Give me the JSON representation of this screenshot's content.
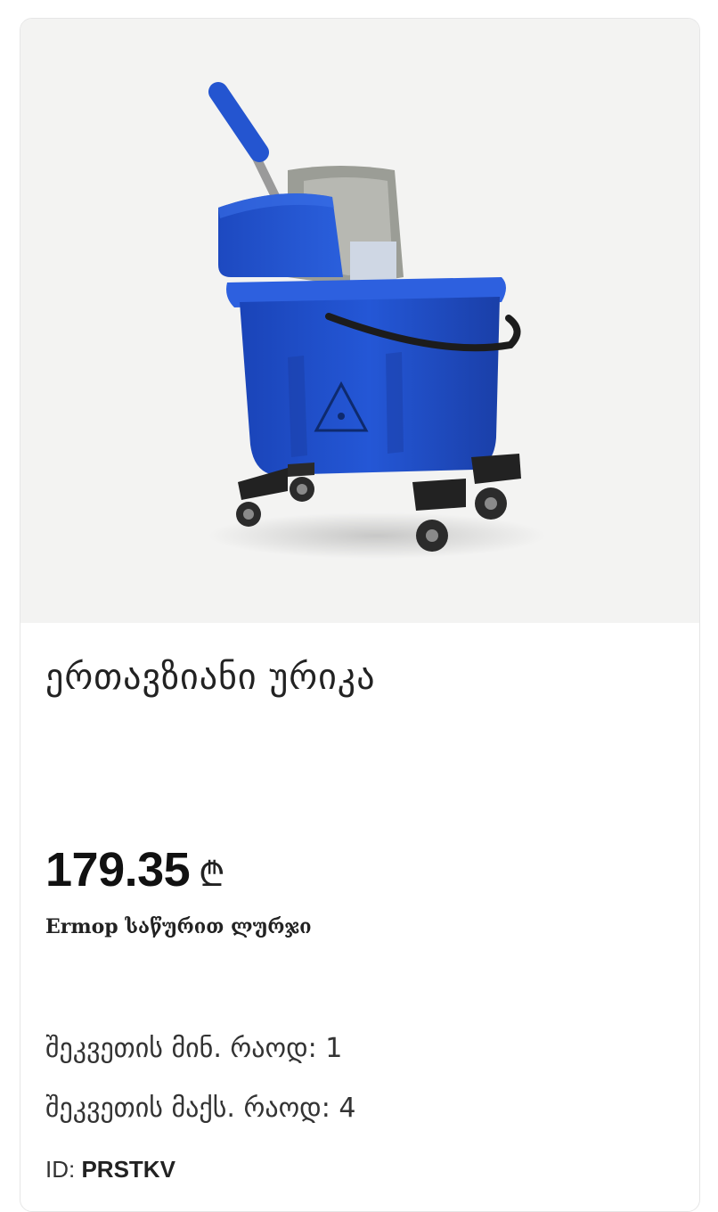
{
  "product": {
    "title": "ერთავზიანი ურიკა",
    "price": "179.35",
    "currency_symbol": "₾",
    "subtitle": "Ermop საწურით ლურჯი",
    "min_order_label": "შეკვეთის მინ. რაოდ:",
    "min_order_value": "1",
    "max_order_label": "შეკვეთის მაქს. რაოდ:",
    "max_order_value": "4",
    "id_label": "ID:",
    "id_value": "PRSTKV"
  },
  "colors": {
    "bucket_blue": "#1f4fc8",
    "image_background": "#f3f3f2"
  },
  "image": {
    "icon": "mop-bucket-image"
  }
}
